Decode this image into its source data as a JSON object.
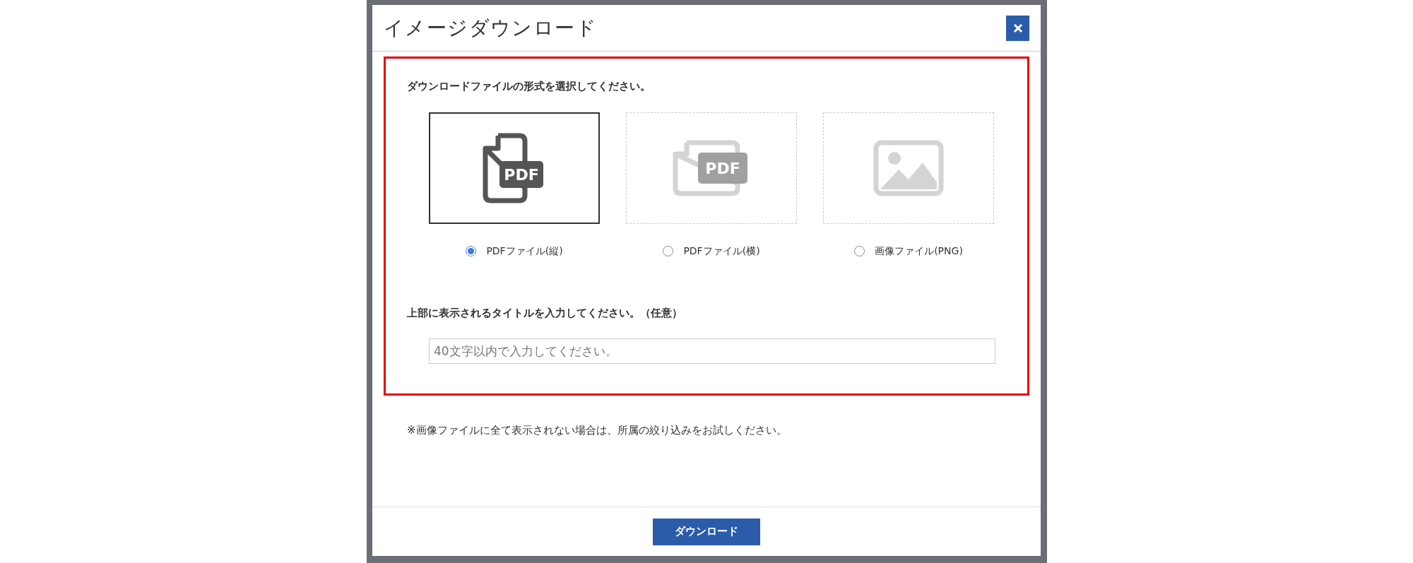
{
  "dialog": {
    "title": "イメージダウンロード",
    "format_section": {
      "heading": "ダウンロードファイルの形式を選択してください。",
      "options": [
        {
          "kind": "pdf-portrait",
          "label": "PDFファイル(縦)",
          "icon_text": "PDF",
          "selected": true
        },
        {
          "kind": "pdf-landscape",
          "label": "PDFファイル(横)",
          "icon_text": "PDF",
          "selected": false
        },
        {
          "kind": "image",
          "label": "画像ファイル(PNG)",
          "selected": false
        }
      ]
    },
    "title_section": {
      "heading": "上部に表示されるタイトルを入力してください。（任意）",
      "placeholder": "40文字以内で入力してください。"
    },
    "note": "※画像ファイルに全て表示されない場合は、所属の絞り込みをお試しください。",
    "button": "ダウンロード"
  }
}
